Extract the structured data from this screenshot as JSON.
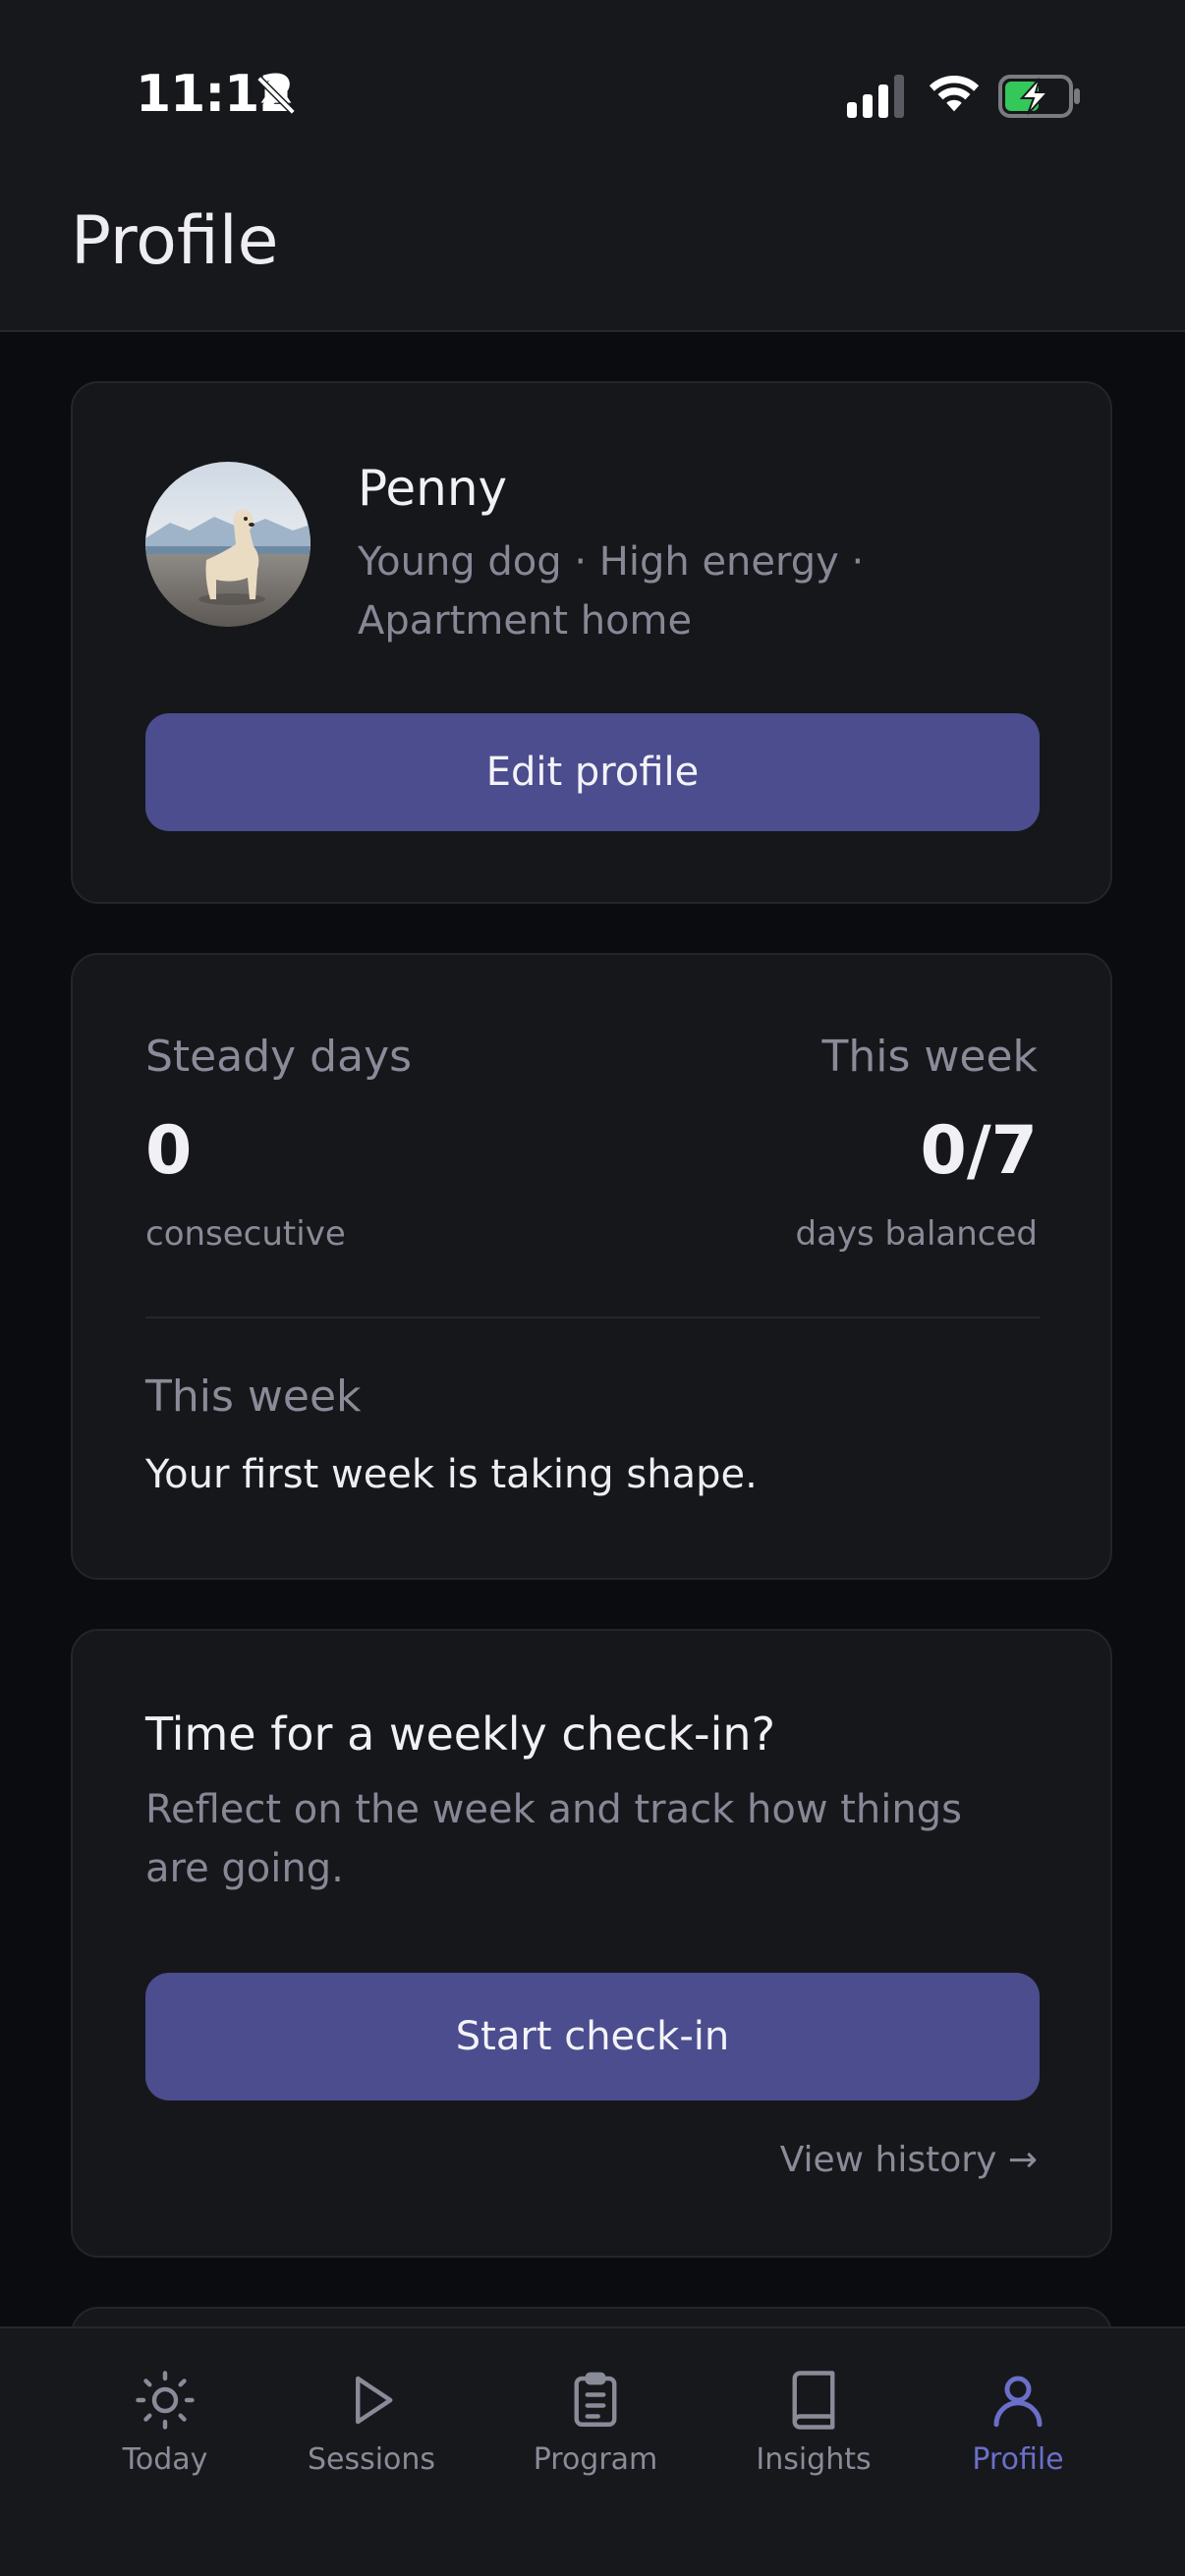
{
  "status_bar": {
    "time": "11:12"
  },
  "header": {
    "title": "Profile"
  },
  "profile_card": {
    "name": "Penny",
    "description": "Young dog · High energy · Apartment home",
    "edit_button": "Edit profile"
  },
  "stats_card": {
    "steady_label": "Steady days",
    "steady_value": "0",
    "steady_sub": "consecutive",
    "week_label": "This week",
    "week_value": "0/7",
    "week_sub": "days balanced",
    "summary_label": "This week",
    "summary_text": "Your first week is taking shape."
  },
  "checkin_card": {
    "title": "Time for a weekly check-in?",
    "description": "Reflect on the week and track how things are going.",
    "start_button": "Start check-in",
    "history_link": "View history →"
  },
  "tabs": [
    {
      "label": "Today",
      "icon": "sun-icon",
      "active": false
    },
    {
      "label": "Sessions",
      "icon": "play-icon",
      "active": false
    },
    {
      "label": "Program",
      "icon": "clipboard-icon",
      "active": false
    },
    {
      "label": "Insights",
      "icon": "book-icon",
      "active": false
    },
    {
      "label": "Profile",
      "icon": "person-icon",
      "active": true
    }
  ],
  "colors": {
    "accent": "#4b4d8e",
    "active_tab": "#6b6fc9",
    "background": "#0b0c0f",
    "card": "#16171b"
  }
}
